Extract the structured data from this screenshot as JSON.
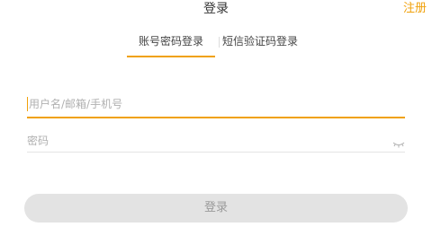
{
  "header": {
    "title": "登录",
    "register_label": "注册"
  },
  "tabs": [
    {
      "label": "账号密码登录",
      "active": true
    },
    {
      "label": "短信验证码登录",
      "active": false
    }
  ],
  "form": {
    "username_placeholder": "用户名/邮箱/手机号",
    "username_value": "",
    "password_placeholder": "密码",
    "password_value": "",
    "password_toggle_icon": "eye-closed-icon",
    "submit_label": "登录"
  },
  "colors": {
    "accent": "#f0a10b",
    "button_disabled_bg": "#e3e3e3",
    "button_disabled_text": "#9a9a9a"
  }
}
